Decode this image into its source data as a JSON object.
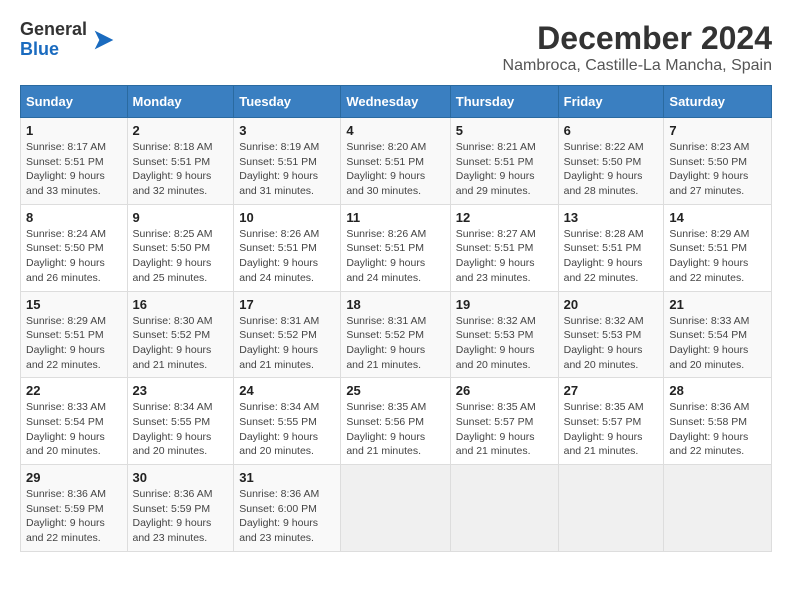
{
  "header": {
    "logo": {
      "general": "General",
      "blue": "Blue"
    },
    "title": "December 2024",
    "location": "Nambroca, Castille-La Mancha, Spain"
  },
  "calendar": {
    "days_of_week": [
      "Sunday",
      "Monday",
      "Tuesday",
      "Wednesday",
      "Thursday",
      "Friday",
      "Saturday"
    ],
    "weeks": [
      [
        {
          "day": "",
          "sunrise": "",
          "sunset": "",
          "daylight": "",
          "empty": true
        },
        {
          "day": "2",
          "sunrise": "Sunrise: 8:18 AM",
          "sunset": "Sunset: 5:51 PM",
          "daylight": "Daylight: 9 hours and 32 minutes.",
          "empty": false
        },
        {
          "day": "3",
          "sunrise": "Sunrise: 8:19 AM",
          "sunset": "Sunset: 5:51 PM",
          "daylight": "Daylight: 9 hours and 31 minutes.",
          "empty": false
        },
        {
          "day": "4",
          "sunrise": "Sunrise: 8:20 AM",
          "sunset": "Sunset: 5:51 PM",
          "daylight": "Daylight: 9 hours and 30 minutes.",
          "empty": false
        },
        {
          "day": "5",
          "sunrise": "Sunrise: 8:21 AM",
          "sunset": "Sunset: 5:51 PM",
          "daylight": "Daylight: 9 hours and 29 minutes.",
          "empty": false
        },
        {
          "day": "6",
          "sunrise": "Sunrise: 8:22 AM",
          "sunset": "Sunset: 5:50 PM",
          "daylight": "Daylight: 9 hours and 28 minutes.",
          "empty": false
        },
        {
          "day": "7",
          "sunrise": "Sunrise: 8:23 AM",
          "sunset": "Sunset: 5:50 PM",
          "daylight": "Daylight: 9 hours and 27 minutes.",
          "empty": false
        }
      ],
      [
        {
          "day": "1",
          "sunrise": "Sunrise: 8:17 AM",
          "sunset": "Sunset: 5:51 PM",
          "daylight": "Daylight: 9 hours and 33 minutes.",
          "empty": false
        },
        {
          "day": "9",
          "sunrise": "Sunrise: 8:25 AM",
          "sunset": "Sunset: 5:50 PM",
          "daylight": "Daylight: 9 hours and 25 minutes.",
          "empty": false
        },
        {
          "day": "10",
          "sunrise": "Sunrise: 8:26 AM",
          "sunset": "Sunset: 5:51 PM",
          "daylight": "Daylight: 9 hours and 24 minutes.",
          "empty": false
        },
        {
          "day": "11",
          "sunrise": "Sunrise: 8:26 AM",
          "sunset": "Sunset: 5:51 PM",
          "daylight": "Daylight: 9 hours and 24 minutes.",
          "empty": false
        },
        {
          "day": "12",
          "sunrise": "Sunrise: 8:27 AM",
          "sunset": "Sunset: 5:51 PM",
          "daylight": "Daylight: 9 hours and 23 minutes.",
          "empty": false
        },
        {
          "day": "13",
          "sunrise": "Sunrise: 8:28 AM",
          "sunset": "Sunset: 5:51 PM",
          "daylight": "Daylight: 9 hours and 22 minutes.",
          "empty": false
        },
        {
          "day": "14",
          "sunrise": "Sunrise: 8:29 AM",
          "sunset": "Sunset: 5:51 PM",
          "daylight": "Daylight: 9 hours and 22 minutes.",
          "empty": false
        }
      ],
      [
        {
          "day": "8",
          "sunrise": "Sunrise: 8:24 AM",
          "sunset": "Sunset: 5:50 PM",
          "daylight": "Daylight: 9 hours and 26 minutes.",
          "empty": false
        },
        {
          "day": "16",
          "sunrise": "Sunrise: 8:30 AM",
          "sunset": "Sunset: 5:52 PM",
          "daylight": "Daylight: 9 hours and 21 minutes.",
          "empty": false
        },
        {
          "day": "17",
          "sunrise": "Sunrise: 8:31 AM",
          "sunset": "Sunset: 5:52 PM",
          "daylight": "Daylight: 9 hours and 21 minutes.",
          "empty": false
        },
        {
          "day": "18",
          "sunrise": "Sunrise: 8:31 AM",
          "sunset": "Sunset: 5:52 PM",
          "daylight": "Daylight: 9 hours and 21 minutes.",
          "empty": false
        },
        {
          "day": "19",
          "sunrise": "Sunrise: 8:32 AM",
          "sunset": "Sunset: 5:53 PM",
          "daylight": "Daylight: 9 hours and 20 minutes.",
          "empty": false
        },
        {
          "day": "20",
          "sunrise": "Sunrise: 8:32 AM",
          "sunset": "Sunset: 5:53 PM",
          "daylight": "Daylight: 9 hours and 20 minutes.",
          "empty": false
        },
        {
          "day": "21",
          "sunrise": "Sunrise: 8:33 AM",
          "sunset": "Sunset: 5:54 PM",
          "daylight": "Daylight: 9 hours and 20 minutes.",
          "empty": false
        }
      ],
      [
        {
          "day": "15",
          "sunrise": "Sunrise: 8:29 AM",
          "sunset": "Sunset: 5:51 PM",
          "daylight": "Daylight: 9 hours and 22 minutes.",
          "empty": false
        },
        {
          "day": "23",
          "sunrise": "Sunrise: 8:34 AM",
          "sunset": "Sunset: 5:55 PM",
          "daylight": "Daylight: 9 hours and 20 minutes.",
          "empty": false
        },
        {
          "day": "24",
          "sunrise": "Sunrise: 8:34 AM",
          "sunset": "Sunset: 5:55 PM",
          "daylight": "Daylight: 9 hours and 20 minutes.",
          "empty": false
        },
        {
          "day": "25",
          "sunrise": "Sunrise: 8:35 AM",
          "sunset": "Sunset: 5:56 PM",
          "daylight": "Daylight: 9 hours and 21 minutes.",
          "empty": false
        },
        {
          "day": "26",
          "sunrise": "Sunrise: 8:35 AM",
          "sunset": "Sunset: 5:57 PM",
          "daylight": "Daylight: 9 hours and 21 minutes.",
          "empty": false
        },
        {
          "day": "27",
          "sunrise": "Sunrise: 8:35 AM",
          "sunset": "Sunset: 5:57 PM",
          "daylight": "Daylight: 9 hours and 21 minutes.",
          "empty": false
        },
        {
          "day": "28",
          "sunrise": "Sunrise: 8:36 AM",
          "sunset": "Sunset: 5:58 PM",
          "daylight": "Daylight: 9 hours and 22 minutes.",
          "empty": false
        }
      ],
      [
        {
          "day": "22",
          "sunrise": "Sunrise: 8:33 AM",
          "sunset": "Sunset: 5:54 PM",
          "daylight": "Daylight: 9 hours and 20 minutes.",
          "empty": false
        },
        {
          "day": "30",
          "sunrise": "Sunrise: 8:36 AM",
          "sunset": "Sunset: 5:59 PM",
          "daylight": "Daylight: 9 hours and 23 minutes.",
          "empty": false
        },
        {
          "day": "31",
          "sunrise": "Sunrise: 8:36 AM",
          "sunset": "Sunset: 6:00 PM",
          "daylight": "Daylight: 9 hours and 23 minutes.",
          "empty": false
        },
        {
          "day": "",
          "sunrise": "",
          "sunset": "",
          "daylight": "",
          "empty": true
        },
        {
          "day": "",
          "sunrise": "",
          "sunset": "",
          "daylight": "",
          "empty": true
        },
        {
          "day": "",
          "sunrise": "",
          "sunset": "",
          "daylight": "",
          "empty": true
        },
        {
          "day": "",
          "sunrise": "",
          "sunset": "",
          "daylight": "",
          "empty": true
        }
      ],
      [
        {
          "day": "29",
          "sunrise": "Sunrise: 8:36 AM",
          "sunset": "Sunset: 5:59 PM",
          "daylight": "Daylight: 9 hours and 22 minutes.",
          "empty": false
        },
        {
          "day": "",
          "sunrise": "",
          "sunset": "",
          "daylight": "",
          "empty": true
        },
        {
          "day": "",
          "sunrise": "",
          "sunset": "",
          "daylight": "",
          "empty": true
        },
        {
          "day": "",
          "sunrise": "",
          "sunset": "",
          "daylight": "",
          "empty": true
        },
        {
          "day": "",
          "sunrise": "",
          "sunset": "",
          "daylight": "",
          "empty": true
        },
        {
          "day": "",
          "sunrise": "",
          "sunset": "",
          "daylight": "",
          "empty": true
        },
        {
          "day": "",
          "sunrise": "",
          "sunset": "",
          "daylight": "",
          "empty": true
        }
      ]
    ]
  }
}
